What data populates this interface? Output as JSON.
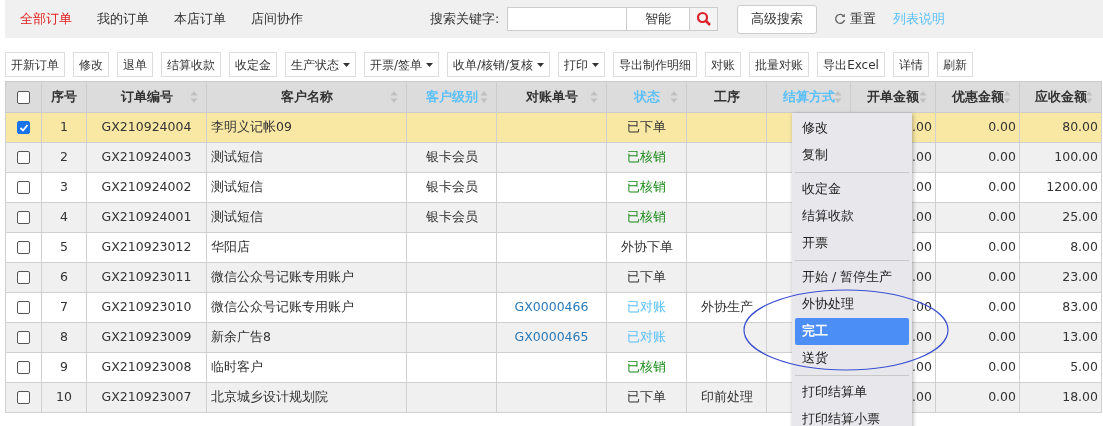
{
  "tabs": [
    {
      "label": "全部订单",
      "selected": true
    },
    {
      "label": "我的订单",
      "selected": false
    },
    {
      "label": "本店订单",
      "selected": false
    },
    {
      "label": "店间协作",
      "selected": false
    }
  ],
  "search": {
    "label": "搜索关键字:",
    "mode": "智能",
    "advanced": "高级搜索",
    "reset": "重置",
    "help": "列表说明"
  },
  "toolbar": [
    {
      "label": "开新订单",
      "dropdown": false
    },
    {
      "label": "修改",
      "dropdown": false
    },
    {
      "label": "退单",
      "dropdown": false
    },
    {
      "label": "结算收款",
      "dropdown": false
    },
    {
      "label": "收定金",
      "dropdown": false
    },
    {
      "label": "生产状态",
      "dropdown": true
    },
    {
      "label": "开票/签单",
      "dropdown": true
    },
    {
      "label": "收单/核销/复核",
      "dropdown": true
    },
    {
      "label": "打印",
      "dropdown": true
    },
    {
      "label": "导出制作明细",
      "dropdown": false
    },
    {
      "label": "对账",
      "dropdown": false
    },
    {
      "label": "批量对账",
      "dropdown": false
    },
    {
      "label": "导出Excel",
      "dropdown": false
    },
    {
      "label": "详情",
      "dropdown": false
    },
    {
      "label": "刷新",
      "dropdown": false
    }
  ],
  "table": {
    "all_checked": false,
    "columns": [
      {
        "label": "序号",
        "accent": false,
        "sortable": false
      },
      {
        "label": "订单编号",
        "accent": false,
        "sortable": true
      },
      {
        "label": "客户名称",
        "accent": false,
        "sortable": true
      },
      {
        "label": "客户级别",
        "accent": true,
        "sortable": true
      },
      {
        "label": "对账单号",
        "accent": false,
        "sortable": true
      },
      {
        "label": "状态",
        "accent": true,
        "sortable": true
      },
      {
        "label": "工序",
        "accent": false,
        "sortable": false
      },
      {
        "label": "结算方式",
        "accent": true,
        "sortable": true
      },
      {
        "label": "开单金额",
        "accent": false,
        "sortable": true
      },
      {
        "label": "优惠金额",
        "accent": false,
        "sortable": true
      },
      {
        "label": "应收金额",
        "accent": false,
        "sortable": true
      }
    ],
    "rows": [
      {
        "checked": true,
        "no": "1",
        "order": "GX210924004",
        "customer": "李明义记帐09",
        "level": "",
        "statement": "",
        "status": {
          "text": "已下单",
          "kind": "ordered"
        },
        "process": "",
        "amount": ".00",
        "discount": "0.00",
        "receivable": "80.00"
      },
      {
        "checked": false,
        "no": "2",
        "order": "GX210924003",
        "customer": "测试短信",
        "level": "银卡会员",
        "statement": "",
        "status": {
          "text": "已核销",
          "kind": "settled"
        },
        "process": "",
        "amount": ".00",
        "discount": "0.00",
        "receivable": "100.00"
      },
      {
        "checked": false,
        "no": "3",
        "order": "GX210924002",
        "customer": "测试短信",
        "level": "银卡会员",
        "statement": "",
        "status": {
          "text": "已核销",
          "kind": "settled"
        },
        "process": "",
        "amount": ".00",
        "discount": "0.00",
        "receivable": "1200.00"
      },
      {
        "checked": false,
        "no": "4",
        "order": "GX210924001",
        "customer": "测试短信",
        "level": "银卡会员",
        "statement": "",
        "status": {
          "text": "已核销",
          "kind": "settled"
        },
        "process": "",
        "amount": ".00",
        "discount": "0.00",
        "receivable": "25.00"
      },
      {
        "checked": false,
        "no": "5",
        "order": "GX210923012",
        "customer": "华阳店",
        "level": "",
        "statement": "",
        "status": {
          "text": "外协下单",
          "kind": "ordered"
        },
        "process": "",
        "amount": ".00",
        "discount": "0.00",
        "receivable": "8.00"
      },
      {
        "checked": false,
        "no": "6",
        "order": "GX210923011",
        "customer": "微信公众号记账专用账户",
        "level": "",
        "statement": "",
        "status": {
          "text": "已下单",
          "kind": "ordered"
        },
        "process": "",
        "amount": ".00",
        "discount": "0.00",
        "receivable": "23.00"
      },
      {
        "checked": false,
        "no": "7",
        "order": "GX210923010",
        "customer": "微信公众号记账专用账户",
        "level": "",
        "statement": "GX0000466",
        "status": {
          "text": "已对账",
          "kind": "reconciled"
        },
        "process": "外协生产",
        "amount": ".00",
        "discount": "0.00",
        "receivable": "83.00"
      },
      {
        "checked": false,
        "no": "8",
        "order": "GX210923009",
        "customer": "新余广告8",
        "level": "",
        "statement": "GX0000465",
        "status": {
          "text": "已对账",
          "kind": "reconciled"
        },
        "process": "",
        "amount": ".00",
        "discount": "0.00",
        "receivable": "13.00"
      },
      {
        "checked": false,
        "no": "9",
        "order": "GX210923008",
        "customer": "临时客户",
        "level": "",
        "statement": "",
        "status": {
          "text": "已核销",
          "kind": "settled"
        },
        "process": "",
        "amount": ".00",
        "discount": "0.00",
        "receivable": "5.00"
      },
      {
        "checked": false,
        "no": "10",
        "order": "GX210923007",
        "customer": "北京城乡设计规划院",
        "level": "",
        "statement": "",
        "status": {
          "text": "已下单",
          "kind": "ordered"
        },
        "process": "印前处理",
        "amount": ".00",
        "discount": "0.00",
        "receivable": "18.00"
      }
    ]
  },
  "context_menu": {
    "groups": [
      [
        {
          "label": "修改",
          "selected": false
        },
        {
          "label": "复制",
          "selected": false
        }
      ],
      [
        {
          "label": "收定金",
          "selected": false
        },
        {
          "label": "结算收款",
          "selected": false
        },
        {
          "label": "开票",
          "selected": false
        }
      ],
      [
        {
          "label": "开始 / 暂停生产",
          "selected": false
        },
        {
          "label": "外协处理",
          "selected": false
        },
        {
          "label": "完工",
          "selected": true
        },
        {
          "label": "送货",
          "selected": false
        }
      ],
      [
        {
          "label": "打印结算单",
          "selected": false
        },
        {
          "label": "打印结算小票",
          "selected": false
        }
      ]
    ]
  }
}
